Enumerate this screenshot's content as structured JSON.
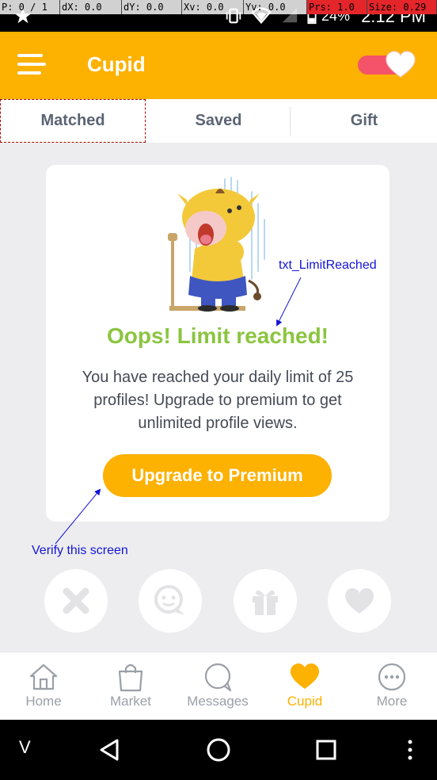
{
  "debug_overlay": {
    "pointer": "P: 0 / 1",
    "dx": "dX: 0.0",
    "dy": "dY: 0.0",
    "xv": "Xv: 0.0",
    "yv": "Yv: 0.0",
    "prs": "Prs: 1.0",
    "size": "Size: 0.29"
  },
  "status_bar": {
    "battery": "24%",
    "time": "2:12 PM"
  },
  "app_bar": {
    "title": "Cupid",
    "toggle_on": true
  },
  "tabs": [
    {
      "label": "Matched",
      "selected": true
    },
    {
      "label": "Saved",
      "selected": false
    },
    {
      "label": "Gift",
      "selected": false
    }
  ],
  "card": {
    "heading": "Oops! Limit reached!",
    "body": "You have reached your daily limit of 25 profiles! Upgrade to premium to get unlimited profile views.",
    "button_label": "Upgrade to Premium"
  },
  "annotations": {
    "limit_label": "txt_LimitReached",
    "verify_label": "Verify this screen"
  },
  "actions": [
    "close-icon",
    "chat-icon",
    "gift-icon",
    "heart-icon"
  ],
  "bottom_nav": [
    {
      "label": "Home",
      "icon": "home-icon",
      "active": false
    },
    {
      "label": "Market",
      "icon": "shopping-bag-icon",
      "active": false
    },
    {
      "label": "Messages",
      "icon": "chat-bubble-icon",
      "active": false
    },
    {
      "label": "Cupid",
      "icon": "heart-icon",
      "active": true
    },
    {
      "label": "More",
      "icon": "more-icon",
      "active": false
    }
  ],
  "system_nav": {
    "keyboard_key": "V"
  },
  "colors": {
    "primary": "#fdb100",
    "accent_green": "#8bc540",
    "toggle_track": "#f4536a",
    "annotation": "#1414d6"
  }
}
